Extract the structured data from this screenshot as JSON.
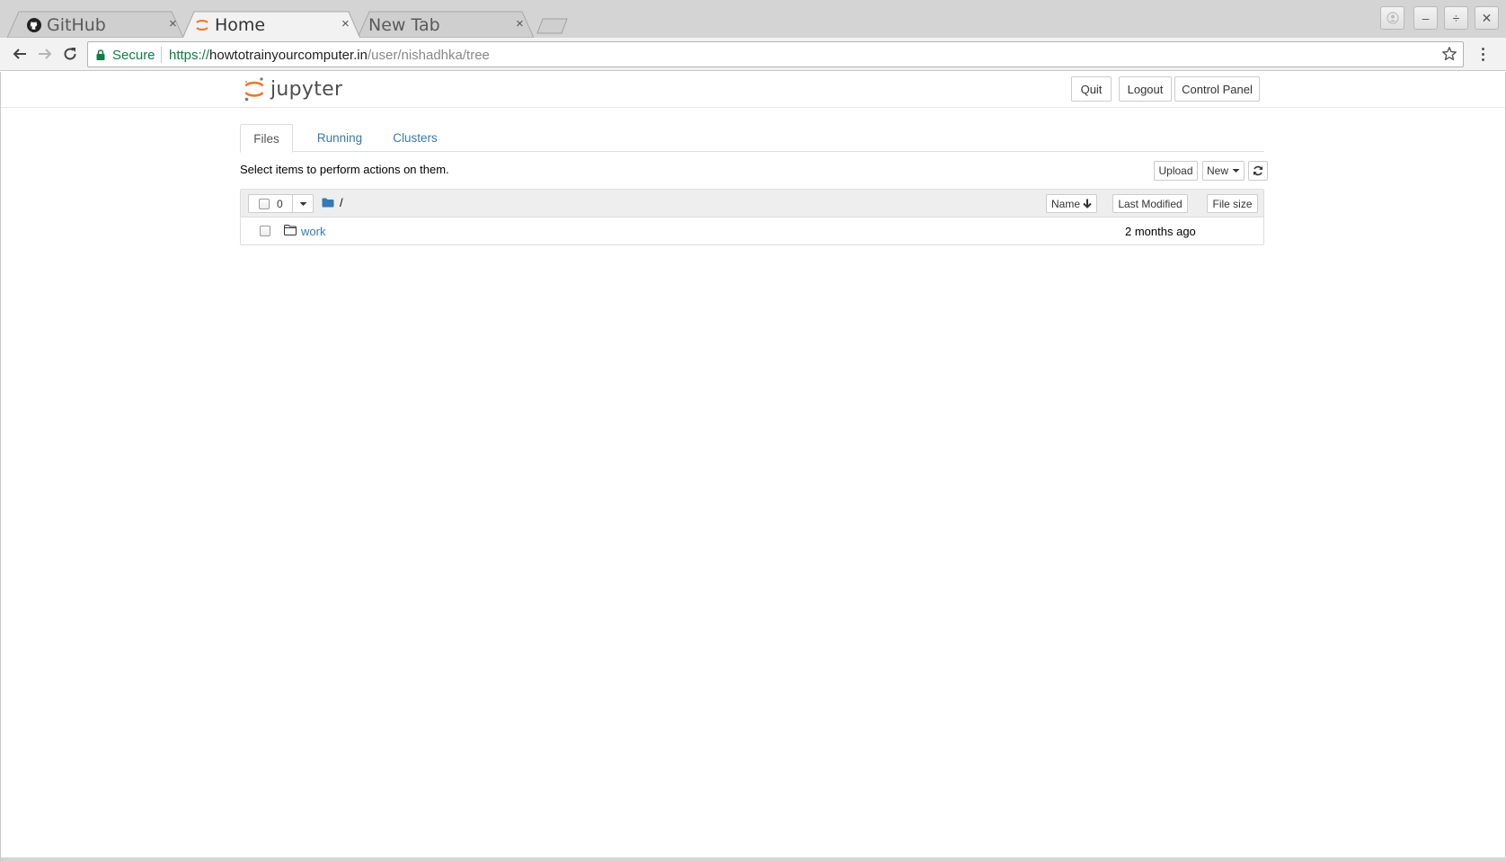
{
  "browser": {
    "tabs": [
      {
        "title": "GitHub",
        "icon": "github-icon",
        "active": false
      },
      {
        "title": "Home",
        "icon": "jupyter-icon",
        "active": true
      },
      {
        "title": "New Tab",
        "icon": "",
        "active": false
      }
    ],
    "close_glyph": "×",
    "window_controls": {
      "minimize": "–",
      "maximize": "÷",
      "close": "✕"
    },
    "omnibox": {
      "secure_label": "Secure",
      "url_scheme": "https://",
      "url_host": "howtotrainyourcomputer.in",
      "url_path": "/user/nishadhka/tree"
    }
  },
  "jupyter": {
    "logo_text": "jupyter",
    "header_buttons": {
      "quit": "Quit",
      "logout": "Logout",
      "control_panel": "Control Panel"
    },
    "tabs": [
      {
        "label": "Files",
        "active": true
      },
      {
        "label": "Running",
        "active": false
      },
      {
        "label": "Clusters",
        "active": false
      }
    ],
    "select_hint": "Select items to perform actions on them.",
    "actions": {
      "upload": "Upload",
      "new": "New"
    },
    "list": {
      "selected_count": "0",
      "breadcrumb": "/",
      "columns": {
        "name": "Name",
        "last_modified": "Last Modified",
        "file_size": "File size"
      },
      "items": [
        {
          "name": "work",
          "type": "folder",
          "modified": "2 months ago"
        }
      ]
    }
  },
  "colors": {
    "link": "#337ab7",
    "jupyter_orange": "#f37726",
    "secure_green": "#0b8043"
  }
}
